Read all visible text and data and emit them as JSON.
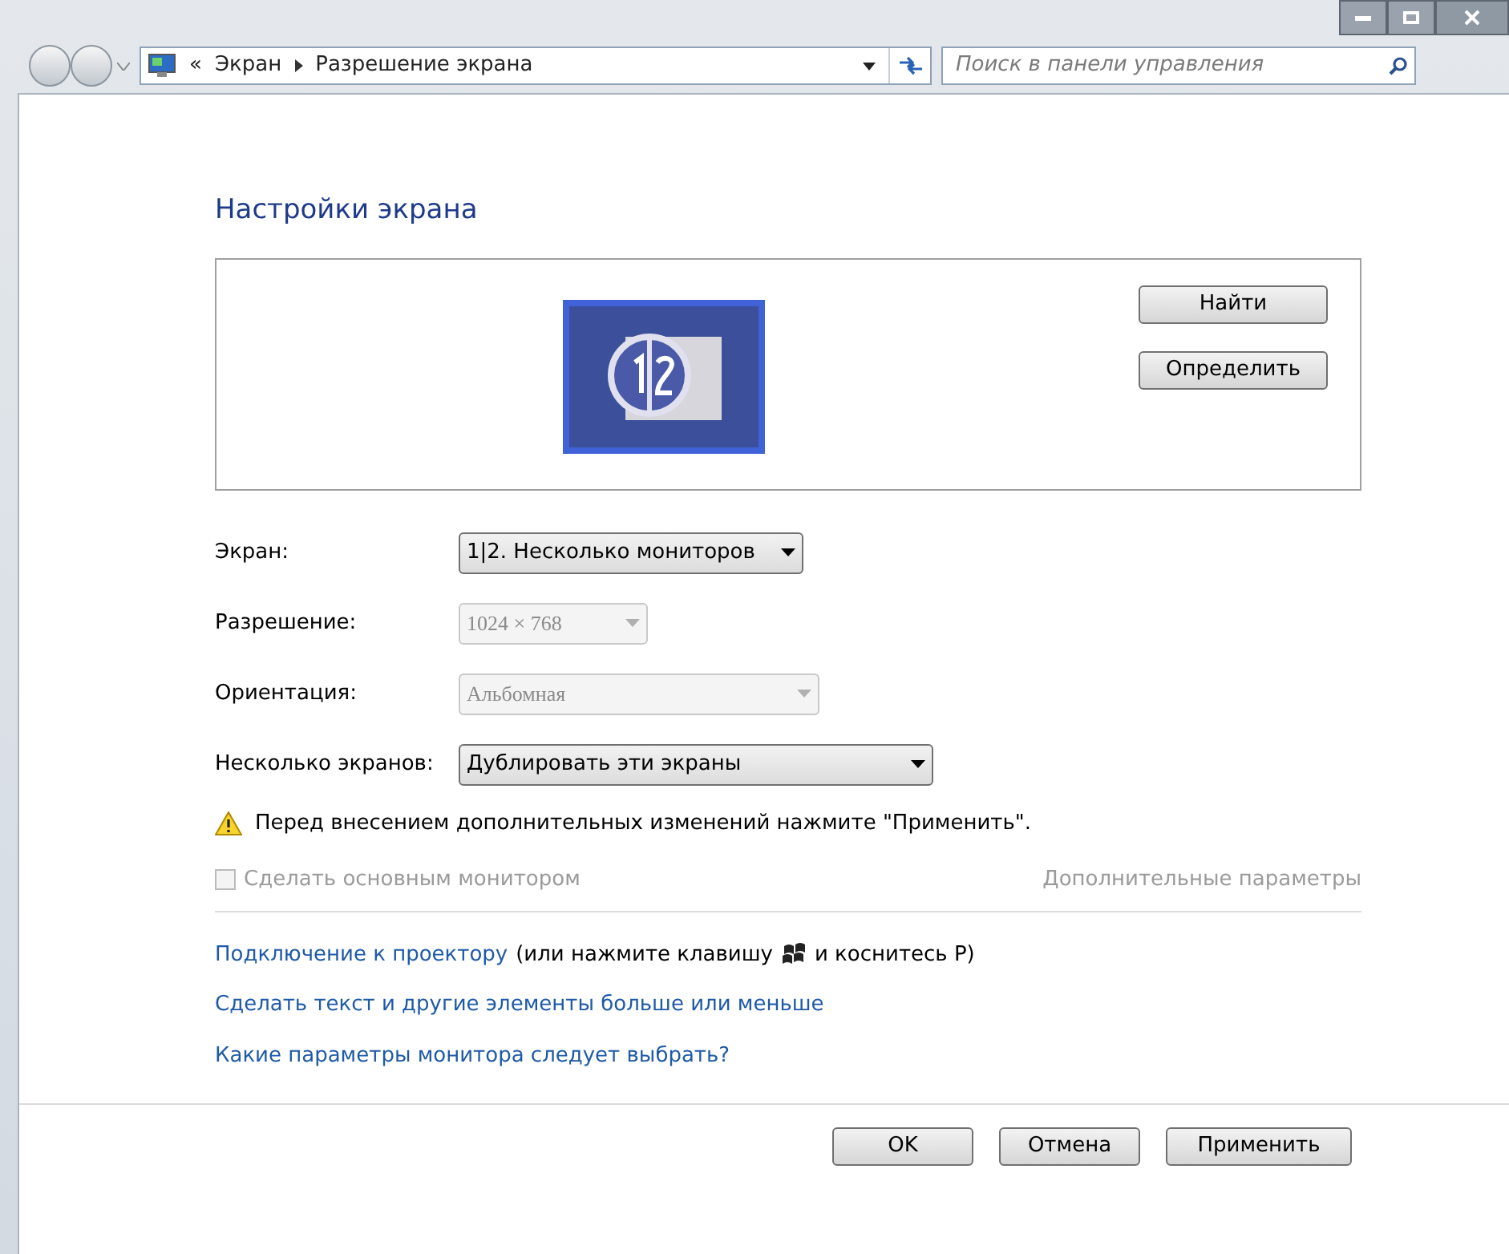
{
  "address_bar": {
    "overflow": "«",
    "breadcrumbs": [
      "Экран",
      "Разрешение экрана"
    ]
  },
  "search": {
    "placeholder": "Поиск в панели управления"
  },
  "heading": "Настройки экрана",
  "preview": {
    "buttons": [
      "Найти",
      "Определить"
    ]
  },
  "fields": [
    {
      "label": "Экран:",
      "value": "1|2. Несколько мониторов",
      "disabled": false
    },
    {
      "label": "Разрешение:",
      "value": "1024 × 768",
      "disabled": true
    },
    {
      "label": "Ориентация:",
      "value": "Альбомная",
      "disabled": true
    },
    {
      "label": "Несколько экранов:",
      "value": "Дублировать эти экраны",
      "disabled": false
    }
  ],
  "warning": "Перед внесением дополнительных изменений нажмите \"Применить\".",
  "primary_monitor": {
    "label": "Сделать основным монитором",
    "checked": false,
    "disabled": true
  },
  "advanced_link": {
    "label": "Дополнительные параметры",
    "disabled": true
  },
  "projector": {
    "link": "Подключение к проектору",
    "before_key": "(или нажмите клавишу",
    "after_key": "и коснитесь P)"
  },
  "links": [
    "Сделать текст и другие элементы больше или меньше",
    "Какие параметры монитора следует выбрать?"
  ],
  "buttons": [
    "OK",
    "Отмена",
    "Применить"
  ]
}
